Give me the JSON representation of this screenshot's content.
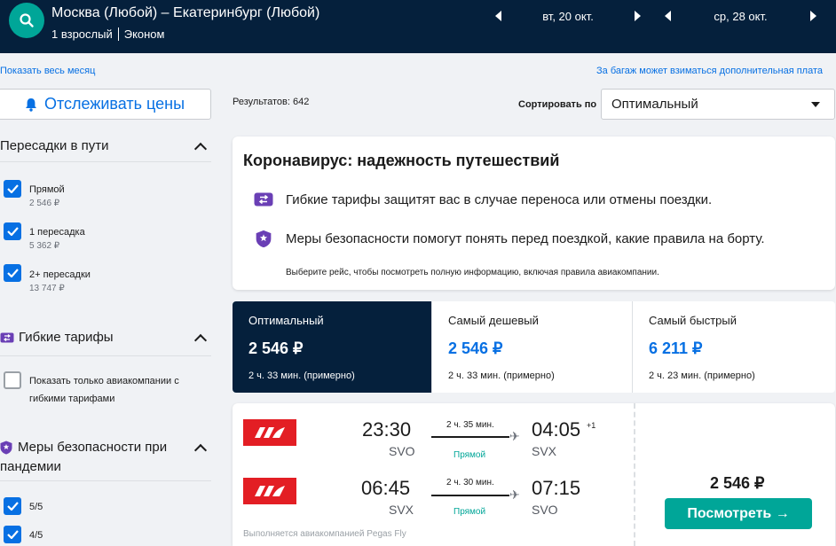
{
  "header": {
    "route": "Москва (Любой) – Екатеринбург (Любой)",
    "passengers": "1 взрослый",
    "cabin": "Эконом",
    "depart_date": "вт, 20 окт.",
    "return_date": "ср, 28 окт."
  },
  "links": {
    "show_month": "Показать весь месяц",
    "baggage_note": "За багаж может взиматься дополнительная плата"
  },
  "sidebar": {
    "track_button": "Отслеживать цены",
    "stops": {
      "title": "Пересадки в пути",
      "options": [
        {
          "label": "Прямой",
          "price": "2 546 ₽",
          "checked": true
        },
        {
          "label": "1 пересадка",
          "price": "5 362 ₽",
          "checked": true
        },
        {
          "label": "2+ пересадки",
          "price": "13 747 ₽",
          "checked": true
        }
      ]
    },
    "flexible": {
      "title": "Гибкие тарифы",
      "option_line1": "Показать только авиакомпании с",
      "option_line2": "гибкими тарифами"
    },
    "safety": {
      "title_line1": "Меры безопасности при",
      "title_line2": "пандемии",
      "options": [
        {
          "label": "5/5",
          "checked": true
        },
        {
          "label": "4/5",
          "checked": true
        }
      ]
    }
  },
  "results": {
    "count_text": "Результатов: 642",
    "sort_label": "Сортировать по",
    "sort_value": "Оптимальный"
  },
  "covid": {
    "title": "Коронавирус: надежность путешествий",
    "row1": "Гибкие тарифы защитят вас в случае переноса или отмены поездки.",
    "row2": "Меры безопасности помогут понять перед поездкой, какие правила на борту.",
    "note": "Выберите рейс, чтобы посмотреть полную информацию, включая правила авиакомпании."
  },
  "tabs": [
    {
      "name": "Оптимальный",
      "price": "2 546 ₽",
      "duration": "2 ч. 33 мин. (примерно)"
    },
    {
      "name": "Самый дешевый",
      "price": "2 546 ₽",
      "duration": "2 ч. 33 мин. (примерно)"
    },
    {
      "name": "Самый быстрый",
      "price": "6 211 ₽",
      "duration": "2 ч. 23 мин. (примерно)"
    }
  ],
  "ticket": {
    "outbound": {
      "dep_time": "23:30",
      "dep_code": "SVO",
      "duration": "2 ч. 35 мин.",
      "stops": "Прямой",
      "arr_time": "04:05",
      "arr_code": "SVX",
      "day_offset": "+1"
    },
    "inbound": {
      "dep_time": "06:45",
      "dep_code": "SVX",
      "duration": "2 ч. 30 мин.",
      "stops": "Прямой",
      "arr_time": "07:15",
      "arr_code": "SVO"
    },
    "operated_by": "Выполняется авиакомпанией Pegas Fly",
    "price": "2 546 ₽",
    "view_button": "Посмотреть →"
  },
  "colors": {
    "navy": "#05203c",
    "teal": "#00a698",
    "blue": "#0770e3",
    "airline_red": "#e31e24"
  }
}
